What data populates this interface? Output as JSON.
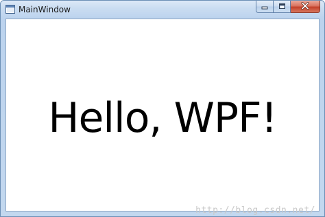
{
  "window": {
    "title": "MainWindow",
    "icons": {
      "app": "window-app-icon",
      "minimize": "minimize-icon",
      "maximize": "maximize-icon",
      "close": "close-icon"
    }
  },
  "content": {
    "text": "Hello, WPF!"
  },
  "watermark": {
    "text": "http://blog.csdn.net/"
  },
  "colors": {
    "titlebar": "#c9dcf1",
    "close_button": "#c3412a",
    "client_background": "#ffffff",
    "text": "#000000"
  }
}
